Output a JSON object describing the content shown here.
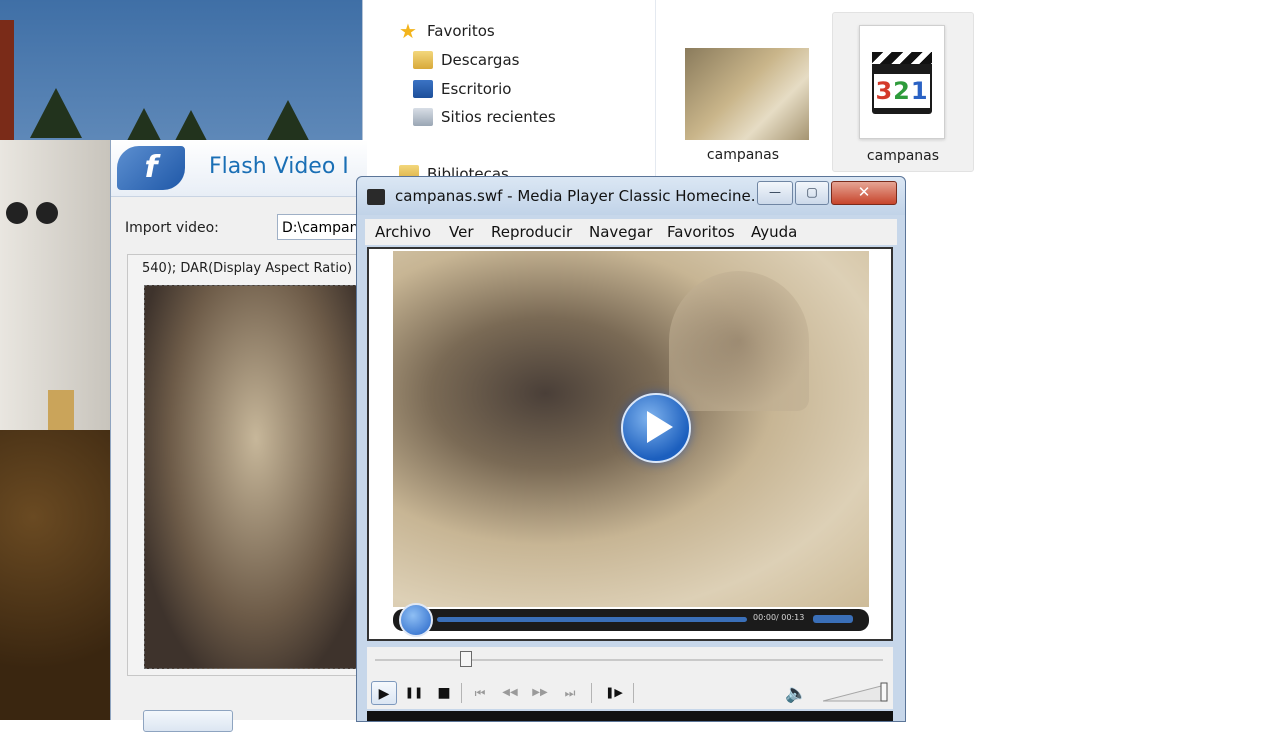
{
  "explorer": {
    "nav": [
      {
        "label": "Favoritos",
        "icon": "star-icon"
      },
      {
        "label": "Descargas",
        "icon": "downloads-folder-icon"
      },
      {
        "label": "Escritorio",
        "icon": "desktop-icon"
      },
      {
        "label": "Sitios recientes",
        "icon": "recent-places-icon"
      },
      {
        "label": "Bibliotecas",
        "icon": "libraries-icon"
      }
    ],
    "files": [
      {
        "label": "campanas",
        "icon": "video-thumbnail"
      },
      {
        "label": "campanas",
        "icon": "media-player-classic-file-icon",
        "badge": "321"
      }
    ]
  },
  "flash_app": {
    "title": "Flash Video I",
    "import_label": "Import video:",
    "import_value": "D:\\campan",
    "info_text": "540);  DAR(Display Aspect Ratio)"
  },
  "player": {
    "title": "campanas.swf - Media Player Classic Homecine...",
    "window_buttons": {
      "minimize": "—",
      "maximize": "▢",
      "close": "✕"
    },
    "menu": [
      "Archivo",
      "Ver",
      "Reproducir",
      "Navegar",
      "Favoritos",
      "Ayuda"
    ],
    "flash_time": "00:00/ 00:13",
    "seek_position": 0.18,
    "controls": {
      "play": "▶",
      "pause": "❚❚",
      "stop": "■",
      "prev": "⏮",
      "rewind": "◀◀",
      "forward": "▶▶",
      "next": "⏭",
      "frame_step": "❚▶",
      "volume": "🔈"
    }
  },
  "colors": {
    "accent": "#1a6fb5",
    "close": "#c7452c",
    "title_bar": "#c7d7ea"
  }
}
